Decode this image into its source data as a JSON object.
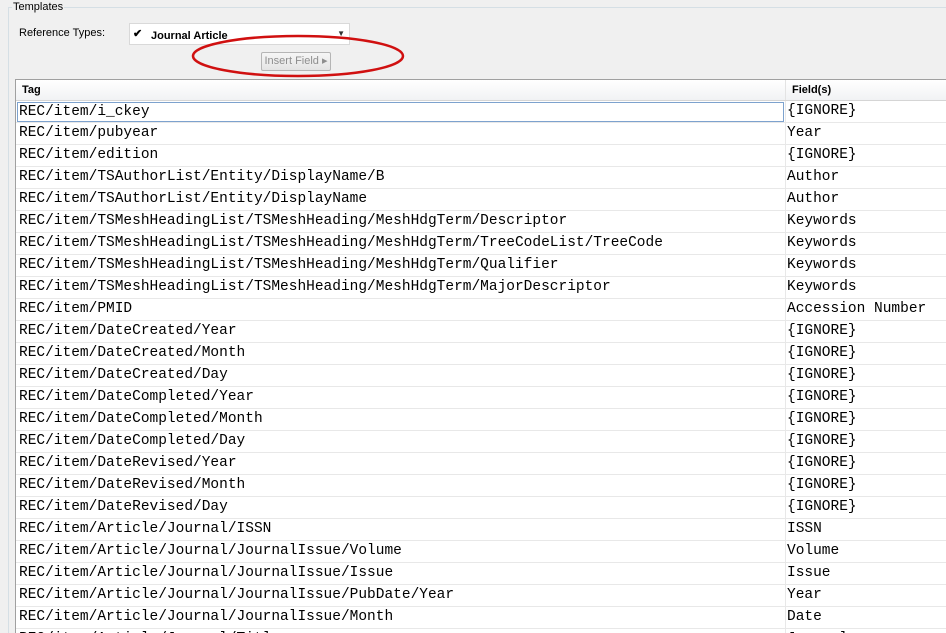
{
  "templates_label": "Templates",
  "reference_types": {
    "label": "Reference Types:",
    "checkmark": "✔",
    "value": "Journal Article"
  },
  "insert_field_label": "Insert Field ▸",
  "table": {
    "columns": [
      "Tag",
      "Field(s)"
    ],
    "rows": [
      {
        "tag": "REC/item/i_ckey",
        "field": "{IGNORE}"
      },
      {
        "tag": "REC/item/pubyear",
        "field": "Year"
      },
      {
        "tag": "REC/item/edition",
        "field": "{IGNORE}"
      },
      {
        "tag": "REC/item/TSAuthorList/Entity/DisplayName/B",
        "field": "Author"
      },
      {
        "tag": "REC/item/TSAuthorList/Entity/DisplayName",
        "field": "Author"
      },
      {
        "tag": "REC/item/TSMeshHeadingList/TSMeshHeading/MeshHdgTerm/Descriptor",
        "field": "Keywords"
      },
      {
        "tag": "REC/item/TSMeshHeadingList/TSMeshHeading/MeshHdgTerm/TreeCodeList/TreeCode",
        "field": "Keywords"
      },
      {
        "tag": "REC/item/TSMeshHeadingList/TSMeshHeading/MeshHdgTerm/Qualifier",
        "field": "Keywords"
      },
      {
        "tag": "REC/item/TSMeshHeadingList/TSMeshHeading/MeshHdgTerm/MajorDescriptor",
        "field": "Keywords"
      },
      {
        "tag": "REC/item/PMID",
        "field": "Accession Number"
      },
      {
        "tag": "REC/item/DateCreated/Year",
        "field": "{IGNORE}"
      },
      {
        "tag": "REC/item/DateCreated/Month",
        "field": "{IGNORE}"
      },
      {
        "tag": "REC/item/DateCreated/Day",
        "field": "{IGNORE}"
      },
      {
        "tag": "REC/item/DateCompleted/Year",
        "field": "{IGNORE}"
      },
      {
        "tag": "REC/item/DateCompleted/Month",
        "field": "{IGNORE}"
      },
      {
        "tag": "REC/item/DateCompleted/Day",
        "field": "{IGNORE}"
      },
      {
        "tag": "REC/item/DateRevised/Year",
        "field": "{IGNORE}"
      },
      {
        "tag": "REC/item/DateRevised/Month",
        "field": "{IGNORE}"
      },
      {
        "tag": "REC/item/DateRevised/Day",
        "field": "{IGNORE}"
      },
      {
        "tag": "REC/item/Article/Journal/ISSN",
        "field": "ISSN"
      },
      {
        "tag": "REC/item/Article/Journal/JournalIssue/Volume",
        "field": "Volume"
      },
      {
        "tag": "REC/item/Article/Journal/JournalIssue/Issue",
        "field": "Issue"
      },
      {
        "tag": "REC/item/Article/Journal/JournalIssue/PubDate/Year",
        "field": "Year"
      },
      {
        "tag": "REC/item/Article/Journal/JournalIssue/Month",
        "field": "Date"
      },
      {
        "tag": "REC/item/Article/Journal/Title",
        "field": "Journal"
      }
    ]
  },
  "colors": {
    "annotation_ellipse": "#d01010",
    "selection_border": "#7da2ce"
  }
}
